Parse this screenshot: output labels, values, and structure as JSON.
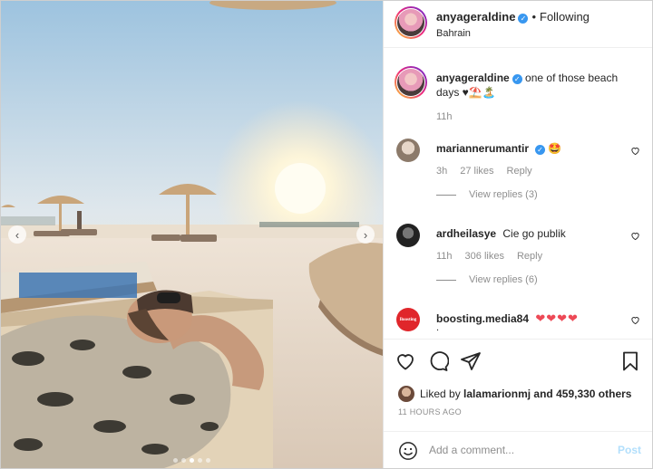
{
  "post": {
    "username": "anyageraldine",
    "follow_separator": "•",
    "follow_label": "Following",
    "location": "Bahrain",
    "caption": "one of those beach days ♥⛱️🏝️",
    "caption_time": "11h",
    "verified_glyph": "✓"
  },
  "comments": [
    {
      "username": "mariannerumantir",
      "text": "🤩",
      "time": "3h",
      "likes": "27 likes",
      "reply_label": "Reply",
      "view_replies": "View replies (3)",
      "avatar_color": "#c9b8a8"
    },
    {
      "username": "ardheilasye",
      "text": "Cie go publik",
      "time": "11h",
      "likes": "306 likes",
      "reply_label": "Reply",
      "view_replies": "View replies (6)",
      "avatar_color": "#3a3a3a"
    },
    {
      "username": "boosting.media84",
      "text": "❤❤❤❤",
      "text_line2": ".",
      "avatar_text": "Boosting",
      "avatar_color": "#e0262b"
    }
  ],
  "likes": {
    "liked_by_prefix": "Liked by",
    "liked_by_user": "lalamarionmj",
    "liked_by_suffix": "and 459,330 others"
  },
  "timestamp": "11 HOURS AGO",
  "add_comment": {
    "placeholder": "Add a comment...",
    "post_label": "Post"
  },
  "carousel": {
    "left_arrow": "‹",
    "right_arrow": "›",
    "dot_count": 5,
    "active_dot": 3
  },
  "colors": {
    "verified": "#3897f0",
    "heart": "#ed4956",
    "post_button": "#b2dffc",
    "meta_gray": "#8e8e8e"
  },
  "icons": {
    "like": "heart-icon",
    "comment": "comment-icon",
    "share": "paper-plane-icon",
    "save": "bookmark-icon",
    "emoji": "smiley-icon"
  }
}
